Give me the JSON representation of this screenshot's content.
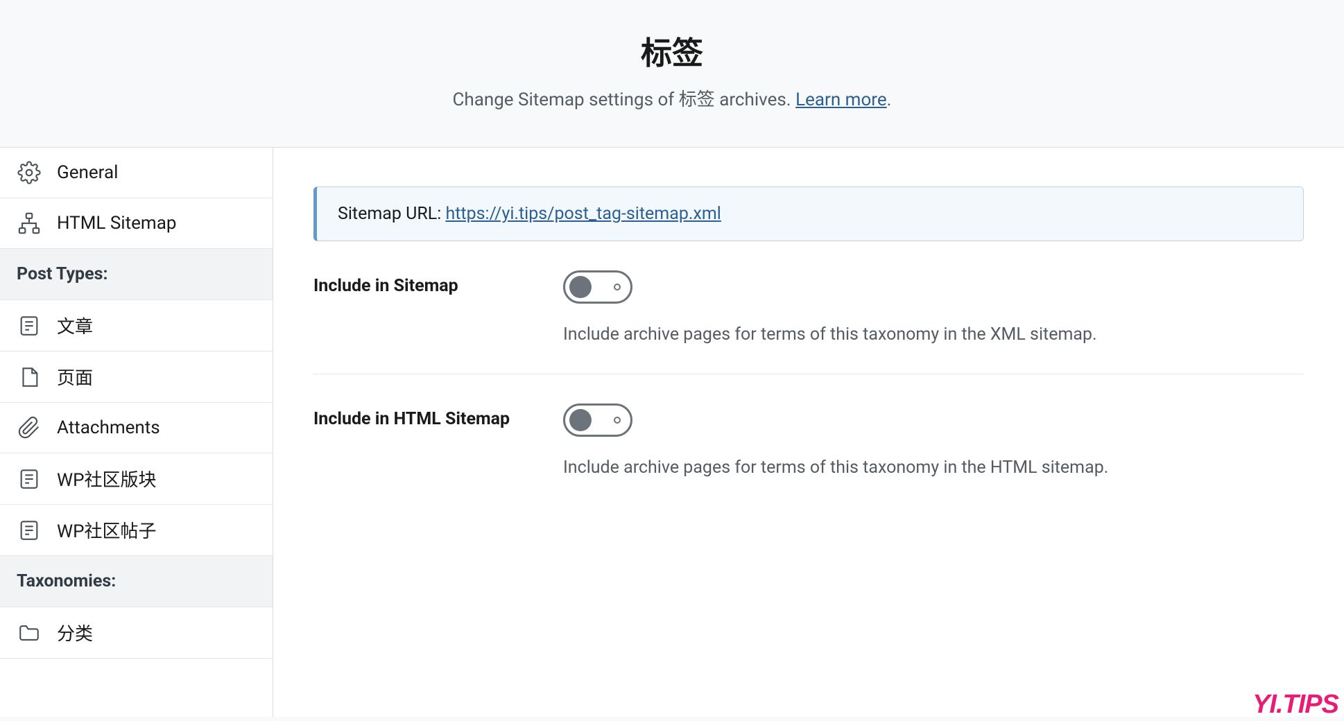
{
  "header": {
    "title": "标签",
    "subtitle_prefix": "Change Sitemap settings of 标签 archives. ",
    "learn_more": "Learn more",
    "period": "."
  },
  "sidebar": {
    "items": [
      {
        "label": "General",
        "icon": "gear"
      },
      {
        "label": "HTML Sitemap",
        "icon": "sitemap"
      }
    ],
    "section_post_types": "Post Types:",
    "post_types": [
      {
        "label": "文章",
        "icon": "document"
      },
      {
        "label": "页面",
        "icon": "page"
      },
      {
        "label": "Attachments",
        "icon": "attachment"
      },
      {
        "label": "WP社区版块",
        "icon": "document"
      },
      {
        "label": "WP社区帖子",
        "icon": "document"
      }
    ],
    "section_taxonomies": "Taxonomies:",
    "taxonomies": [
      {
        "label": "分类",
        "icon": "folder"
      }
    ]
  },
  "main": {
    "sitemap_url_label": "Sitemap URL: ",
    "sitemap_url": "https://yi.tips/post_tag-sitemap.xml",
    "options": [
      {
        "label": "Include in Sitemap",
        "help": "Include archive pages for terms of this taxonomy in the XML sitemap.",
        "enabled": false
      },
      {
        "label": "Include in HTML Sitemap",
        "help": "Include archive pages for terms of this taxonomy in the HTML sitemap.",
        "enabled": false
      }
    ]
  },
  "watermark": {
    "text": "YI.TIPS",
    "subtext": "YI.TIPS"
  }
}
